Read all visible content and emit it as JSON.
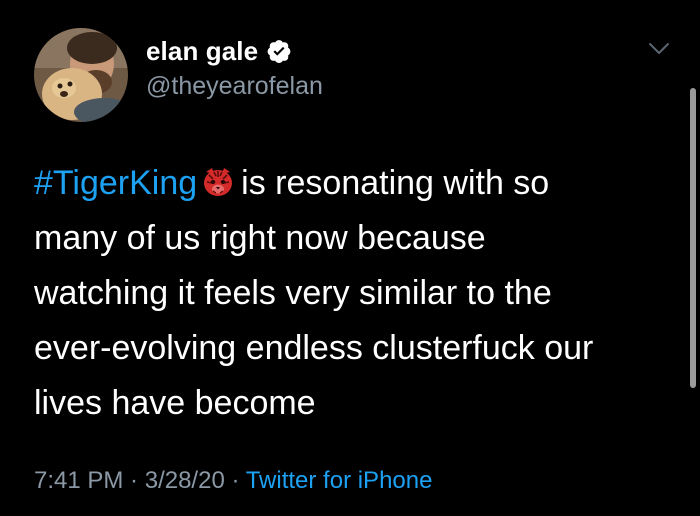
{
  "tweet": {
    "author": {
      "display_name": "elan gale",
      "handle": "@theyearofelan",
      "verified": true
    },
    "text": {
      "hashtag": "#TigerKing",
      "emoji": "tiger-face-emoji",
      "line1_rest": "is resonating with so",
      "line2": "many of us right now because",
      "line3": "watching it feels very similar to the",
      "line4": "ever-evolving endless clusterfuck our",
      "line5": "lives have become"
    },
    "meta": {
      "time": "7:41 PM",
      "separator1": " · ",
      "date": "3/28/20",
      "separator2": " · ",
      "source": "Twitter for iPhone"
    }
  },
  "colors": {
    "background": "#000000",
    "text": "#ffffff",
    "secondary": "#8b98a5",
    "accent": "#1da1f2",
    "emoji_red": "#d42a2a"
  },
  "icons": {
    "verified": "verified-badge-icon",
    "menu": "chevron-down-icon"
  }
}
